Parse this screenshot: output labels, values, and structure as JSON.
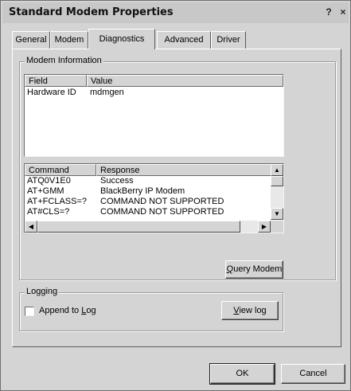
{
  "window": {
    "title": "Standard Modem Properties",
    "help_glyph": "?",
    "close_glyph": "×"
  },
  "tabs": [
    {
      "label": "General"
    },
    {
      "label": "Modem"
    },
    {
      "label": "Diagnostics"
    },
    {
      "label": "Advanced"
    },
    {
      "label": "Driver"
    }
  ],
  "modem_info": {
    "group_label": "Modem Information",
    "top_table": {
      "headers": [
        "Field",
        "Value"
      ],
      "rows": [
        [
          "Hardware ID",
          "mdmgen"
        ]
      ]
    },
    "command_table": {
      "headers": [
        "Command",
        "Response"
      ],
      "rows": [
        [
          "ATQ0V1E0",
          "Success"
        ],
        [
          "AT+GMM",
          "BlackBerry IP Modem"
        ],
        [
          "AT+FCLASS=?",
          "COMMAND NOT SUPPORTED"
        ],
        [
          "AT#CLS=?",
          "COMMAND NOT SUPPORTED"
        ]
      ]
    },
    "query_button": {
      "pre": "",
      "accel": "Q",
      "post": "uery Modem"
    }
  },
  "logging": {
    "group_label": "Logging",
    "append_checkbox": {
      "pre": "Append to ",
      "accel": "L",
      "post": "og",
      "checked": false
    },
    "view_log_button": {
      "pre": "",
      "accel": "V",
      "post": "iew log"
    }
  },
  "footer": {
    "ok_label": "OK",
    "cancel_label": "Cancel"
  }
}
